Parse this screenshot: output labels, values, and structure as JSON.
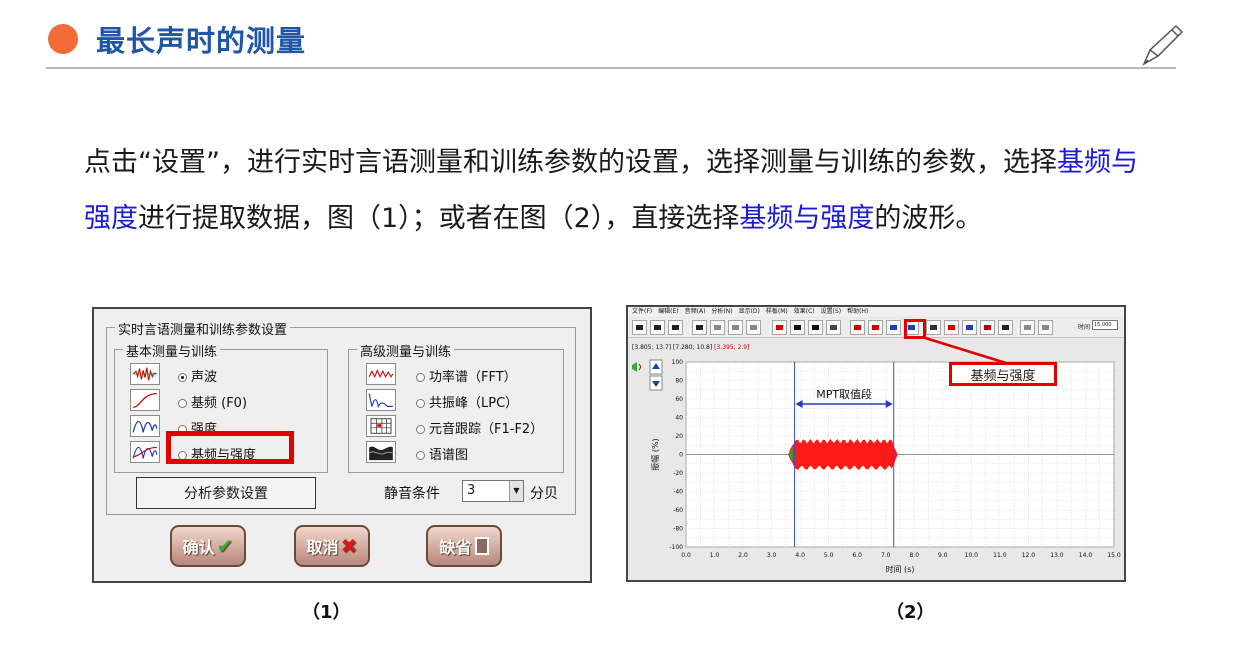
{
  "title": "最长声时的测量",
  "description": {
    "p1": "点击“设置”，进行实时言语测量和训练参数的设置，选择测量与训练的参数，选择",
    "hl1": "基频与强度",
    "p2": "进行提取数据，图（1）；或者在图（2），直接选择",
    "hl2": "基频与强度",
    "p3": "的波形。"
  },
  "dialog": {
    "group_title": "实时言语测量和训练参数设置",
    "basic_title": "基本测量与训练",
    "basic_options": [
      "声波",
      "基频 (F0)",
      "强度",
      "基频与强度"
    ],
    "selected_basic": "声波",
    "advanced_title": "高级测量与训练",
    "advanced_options": [
      "功率谱（FFT）",
      "共振峰（LPC）",
      "元音跟踪（F1-F2）",
      "语谱图"
    ],
    "analysis_button": "分析参数设置",
    "silence_label": "静音条件",
    "silence_value": "3",
    "silence_unit": "分贝",
    "confirm_button": "确认",
    "cancel_button": "取消",
    "default_button": "缺省"
  },
  "caption1": "（1）",
  "caption2": "（2）",
  "app": {
    "menu": [
      "文件(F)",
      "编辑(E)",
      "音频(A)",
      "分析(N)",
      "显示(D)",
      "样板(M)",
      "效果(C)",
      "设置(S)",
      "帮助(H)"
    ],
    "time_label": "时间",
    "time_value": "15.000",
    "coord_readout": "[3.805; 13.7]  [7.280; 10.8]",
    "coord_readout_red": "[3.395; 2.9]",
    "callout": "基频与强度",
    "segment_label": "MPT取值段"
  },
  "chart_data": {
    "type": "area",
    "xlabel": "时间 (s)",
    "ylabel": "振幅 (%)",
    "xlim": [
      0,
      15
    ],
    "ylim": [
      -100,
      100
    ],
    "x_ticks": [
      "0.0",
      "1.0",
      "2.0",
      "3.0",
      "4.0",
      "5.0",
      "6.0",
      "7.0",
      "8.0",
      "9.0",
      "10.0",
      "11.0",
      "12.0",
      "13.0",
      "14.0",
      "15.0"
    ],
    "y_ticks": [
      "100",
      "80",
      "60",
      "40",
      "20",
      "0",
      "-20",
      "-40",
      "-60",
      "-80",
      "-100"
    ],
    "grid": true,
    "segment": {
      "start": 3.805,
      "end": 7.28
    },
    "signal": {
      "start": 3.6,
      "end": 7.4,
      "amplitude": 16
    },
    "colors": {
      "signal": "#ff1a1a",
      "signal_edge": "#1db21d",
      "cursor": "#3b4fb0"
    }
  }
}
